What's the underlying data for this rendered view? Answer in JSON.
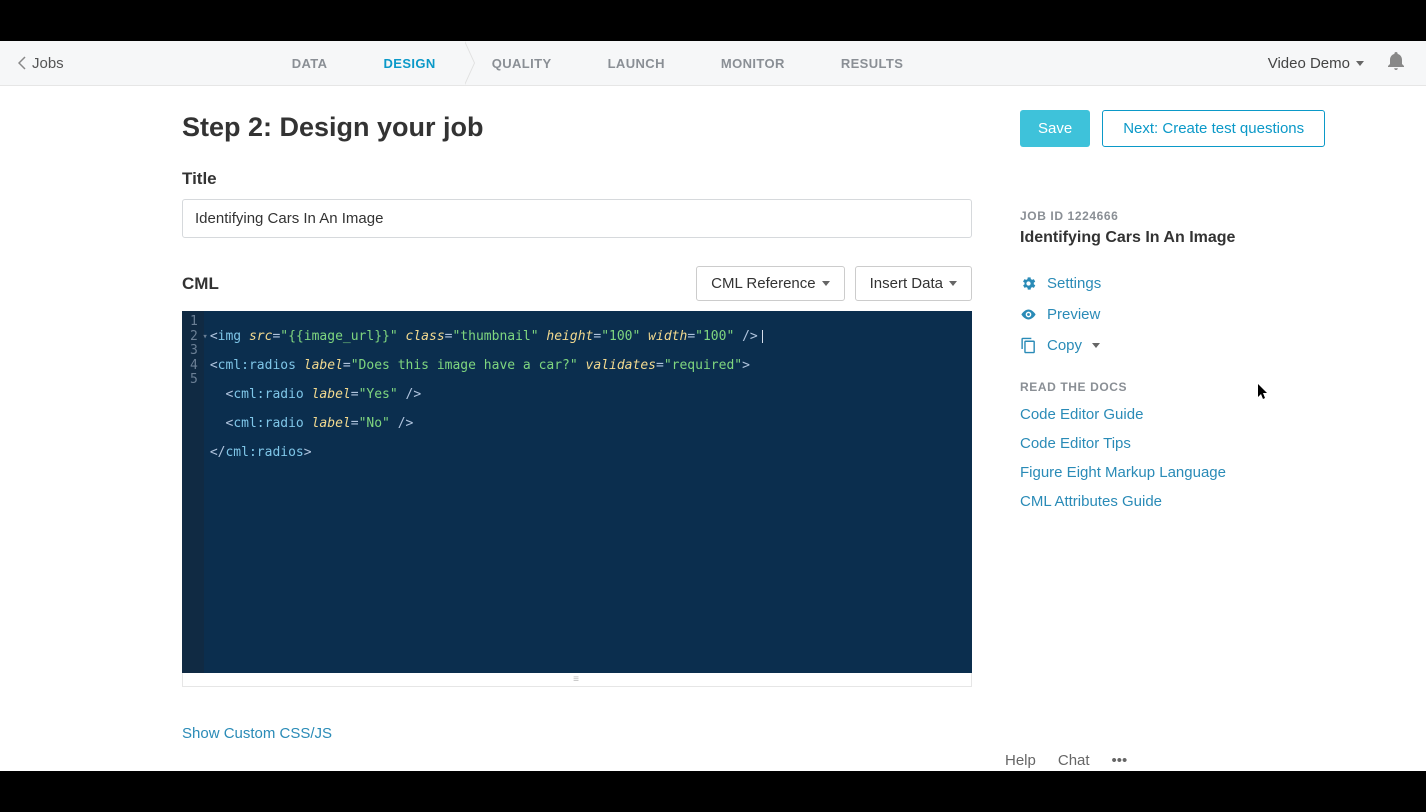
{
  "topbar": {
    "back_label": "Jobs",
    "tabs": [
      "DATA",
      "DESIGN",
      "QUALITY",
      "LAUNCH",
      "MONITOR",
      "RESULTS"
    ],
    "active_tab_index": 1,
    "project_name": "Video Demo"
  },
  "header": {
    "page_title": "Step 2: Design your job",
    "save_label": "Save",
    "next_label": "Next: Create test questions"
  },
  "title_section": {
    "label": "Title",
    "value": "Identifying Cars In An Image"
  },
  "cml_section": {
    "label": "CML",
    "reference_btn": "CML Reference",
    "insert_btn": "Insert Data",
    "line_numbers": [
      "1",
      "2",
      "3",
      "4",
      "5"
    ],
    "code_lines": [
      {
        "raw": "<img src=\"{{image_url}}\" class=\"thumbnail\" height=\"100\" width=\"100\" />"
      },
      {
        "raw": "<cml:radios label=\"Does this image have a car?\" validates=\"required\">"
      },
      {
        "raw": "  <cml:radio label=\"Yes\" />"
      },
      {
        "raw": "  <cml:radio label=\"No\" />"
      },
      {
        "raw": "</cml:radios>"
      }
    ],
    "show_cssjs": "Show Custom CSS/JS"
  },
  "sidebar": {
    "job_id_label": "JOB ID 1224666",
    "job_title": "Identifying Cars In An Image",
    "links": [
      {
        "icon": "gear",
        "label": "Settings"
      },
      {
        "icon": "eye",
        "label": "Preview"
      },
      {
        "icon": "copy",
        "label": "Copy",
        "has_caret": true
      }
    ],
    "docs_heading": "READ THE DOCS",
    "docs": [
      "Code Editor Guide",
      "Code Editor Tips",
      "Figure Eight Markup Language",
      "CML Attributes Guide"
    ]
  },
  "footer": {
    "help": "Help",
    "chat": "Chat"
  }
}
